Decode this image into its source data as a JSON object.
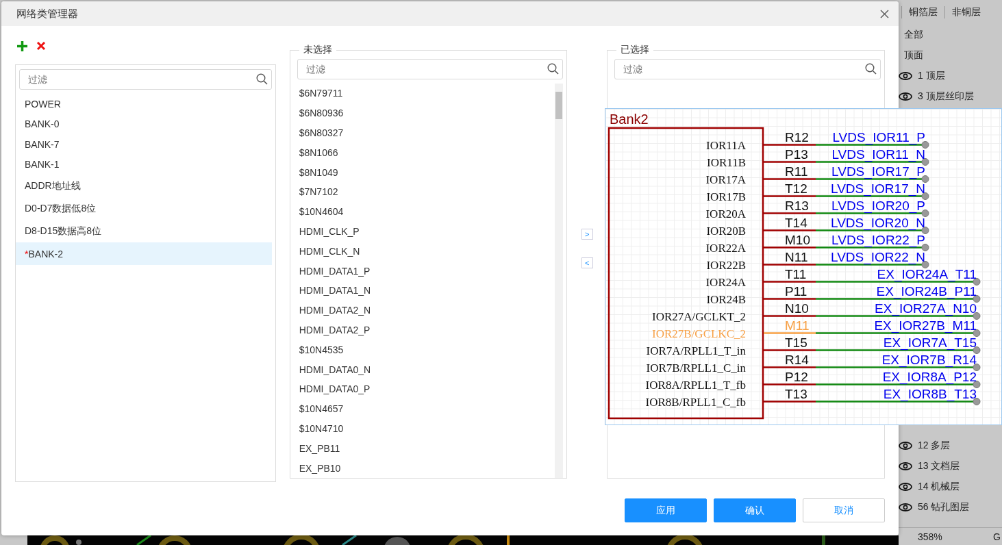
{
  "dialog": {
    "title": "网络类管理器",
    "classes": {
      "filter_placeholder": "过滤",
      "items": [
        {
          "label": "POWER",
          "selected": false
        },
        {
          "label": "BANK-0",
          "selected": false
        },
        {
          "label": "BANK-7",
          "selected": false
        },
        {
          "label": "BANK-1",
          "selected": false
        },
        {
          "label": "ADDR地址线",
          "selected": false
        },
        {
          "label": "D0-D7数据低8位",
          "selected": false
        },
        {
          "label": "D8-D15数据高8位",
          "selected": false
        },
        {
          "label": "BANK-2",
          "selected": true,
          "flag": "*"
        }
      ]
    },
    "unselected": {
      "title": "未选择",
      "filter_placeholder": "过滤",
      "items": [
        "$6N79711",
        "$6N80936",
        "$6N80327",
        "$8N1066",
        "$8N1049",
        "$7N7102",
        "$10N4604",
        "HDMI_CLK_P",
        "HDMI_CLK_N",
        "HDMI_DATA1_P",
        "HDMI_DATA1_N",
        "HDMI_DATA2_N",
        "HDMI_DATA2_P",
        "$10N4535",
        "HDMI_DATA0_N",
        "HDMI_DATA0_P",
        "$10N4657",
        "$10N4710",
        "EX_PB11",
        "EX_PB10"
      ]
    },
    "move_buttons": [
      ">",
      "<"
    ],
    "selected": {
      "title": "已选择",
      "filter_placeholder": "过滤"
    },
    "buttons": [
      {
        "label": "应用",
        "kind": "primary"
      },
      {
        "label": "确认",
        "kind": "primary"
      },
      {
        "label": "取消",
        "kind": "secondary"
      }
    ]
  },
  "schematic_preview": {
    "title": "Bank2",
    "pins": [
      {
        "name": "IOR11A",
        "number": "R12",
        "net": "LVDS_IOR11_P",
        "kind": "short",
        "highlighted": false
      },
      {
        "name": "IOR11B",
        "number": "P13",
        "net": "LVDS_IOR11_N",
        "kind": "short",
        "highlighted": false
      },
      {
        "name": "IOR17A",
        "number": "R11",
        "net": "LVDS_IOR17_P",
        "kind": "short",
        "highlighted": false
      },
      {
        "name": "IOR17B",
        "number": "T12",
        "net": "LVDS_IOR17_N",
        "kind": "short",
        "highlighted": false
      },
      {
        "name": "IOR20A",
        "number": "R13",
        "net": "LVDS_IOR20_P",
        "kind": "short",
        "highlighted": false
      },
      {
        "name": "IOR20B",
        "number": "T14",
        "net": "LVDS_IOR20_N",
        "kind": "short",
        "highlighted": false
      },
      {
        "name": "IOR22A",
        "number": "M10",
        "net": "LVDS_IOR22_P",
        "kind": "short",
        "highlighted": false
      },
      {
        "name": "IOR22B",
        "number": "N11",
        "net": "LVDS_IOR22_N",
        "kind": "short",
        "highlighted": false
      },
      {
        "name": "IOR24A",
        "number": "T11",
        "net": "EX_IOR24A_T11",
        "kind": "long",
        "highlighted": false
      },
      {
        "name": "IOR24B",
        "number": "P11",
        "net": "EX_IOR24B_P11",
        "kind": "long",
        "highlighted": false
      },
      {
        "name": "IOR27A/GCLKT_2",
        "number": "N10",
        "net": "EX_IOR27A_N10",
        "kind": "long",
        "highlighted": false
      },
      {
        "name": "IOR27B/GCLKC_2",
        "number": "M11",
        "net": "EX_IOR27B_M11",
        "kind": "long",
        "highlighted": true
      },
      {
        "name": "IOR7A/RPLL1_T_in",
        "number": "T15",
        "net": "EX_IOR7A_T15",
        "kind": "long",
        "highlighted": false
      },
      {
        "name": "IOR7B/RPLL1_C_in",
        "number": "R14",
        "net": "EX_IOR7B_R14",
        "kind": "long",
        "highlighted": false
      },
      {
        "name": "IOR8A/RPLL1_T_fb",
        "number": "P12",
        "net": "EX_IOR8A_P12",
        "kind": "long",
        "highlighted": false
      },
      {
        "name": "IOR8B/RPLL1_C_fb",
        "number": "T13",
        "net": "EX_IOR8B_T13",
        "kind": "long",
        "highlighted": false
      }
    ]
  },
  "layer_panel": {
    "tabs": [
      "铜箔层",
      "非铜层"
    ],
    "groups": [
      "全部",
      "顶面"
    ],
    "layers_top": [
      {
        "label": "1 顶层",
        "visible": true
      },
      {
        "label": "3 顶层丝印层",
        "visible": true
      }
    ],
    "layers_bottom": [
      {
        "label": "12 多层",
        "visible": true
      },
      {
        "label": "13 文档层",
        "visible": true
      },
      {
        "label": "14 机械层",
        "visible": true
      },
      {
        "label": "56 钻孔图层",
        "visible": true
      }
    ]
  },
  "status_bar": {
    "zoom": "358%",
    "right": "G"
  }
}
